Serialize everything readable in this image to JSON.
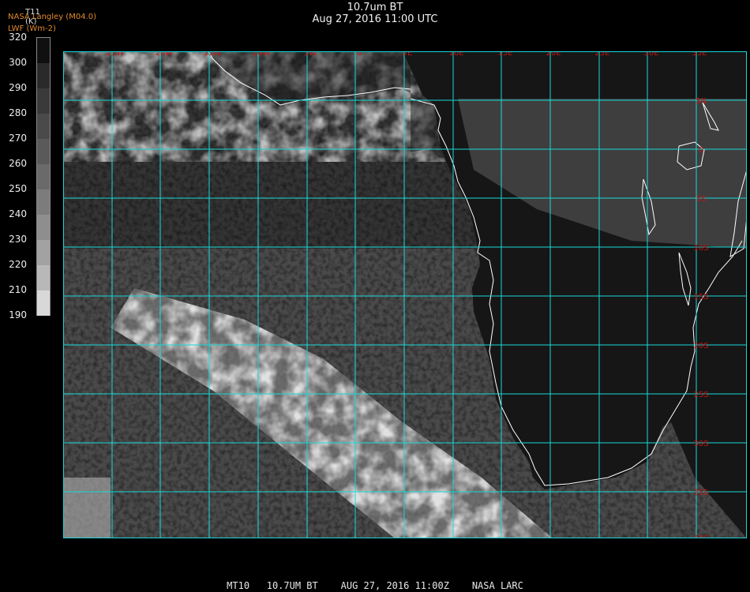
{
  "title": {
    "main": "10.7um BT",
    "sub": "Aug 27, 2016 11:00 UTC"
  },
  "credits": {
    "line1": "NASA Langley (M04.0)",
    "line2": "LWF (Wm-2)"
  },
  "colorbar": {
    "variable": "T11",
    "unit": "(K)",
    "ticks": [
      "320",
      "300",
      "290",
      "280",
      "270",
      "260",
      "250",
      "240",
      "230",
      "220",
      "210",
      "190"
    ],
    "colors": [
      "#101010",
      "#2a2a2a",
      "#3a3a3a",
      "#4a4a4a",
      "#5a5a5a",
      "#6a6a6a",
      "#7c7c7c",
      "#8e8e8e",
      "#a2a2a2",
      "#b8b8b8",
      "#d8d8d8"
    ]
  },
  "map": {
    "colors": {
      "grid": "#19d8d8",
      "coast": "#ffffff",
      "labels": "#c81414",
      "ocean": "#4a4a4a",
      "land": "#161616"
    },
    "lon_labels": [
      "25W",
      "20W",
      "15W",
      "10W",
      "5W",
      "0",
      "5E",
      "10E",
      "15E",
      "20E",
      "25E",
      "30E",
      "35E"
    ],
    "lat_labels": [
      "5N",
      "0",
      "5S",
      "10S",
      "15S",
      "20S",
      "25S",
      "30S",
      "35S",
      "40S"
    ]
  },
  "footer": "MT10   10.7UM BT    AUG 27, 2016 11:00Z    NASA LARC"
}
